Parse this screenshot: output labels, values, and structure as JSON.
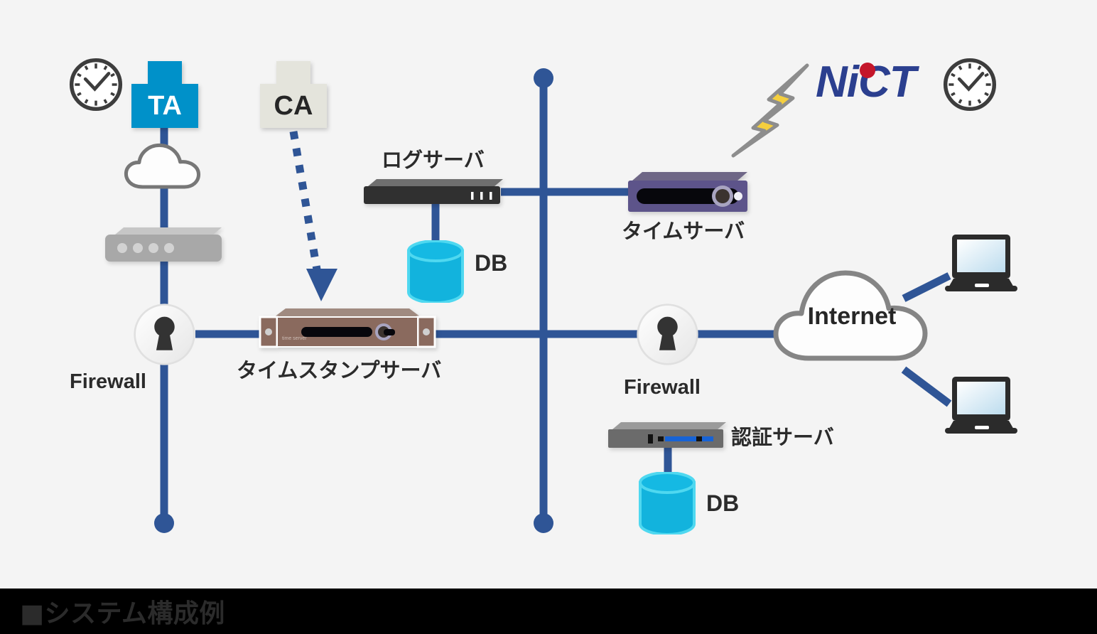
{
  "caption": {
    "bullet": "■",
    "text": "システム構成例",
    "full": "■システム構成例"
  },
  "colors": {
    "wire_blue": "#2f5596",
    "ta_blue": "#0091c9",
    "ca_gray": "#e4e4dc",
    "db_cyan": "#12b3dd",
    "log_server_dark": "#303030",
    "time_server_purple": "#5d548a",
    "timestamp_server_brown": "#8a6a5e",
    "auth_server_gray": "#6b6b6b",
    "router_gray": "#a8a8a8",
    "nict_blue": "#2b3f8f",
    "nict_red": "#c4162a",
    "bolt_yellow": "#f5cf3e",
    "canvas_bg": "#f4f4f4",
    "caption_bg": "#000000",
    "caption_text": "#2b2b2b"
  },
  "nodes": {
    "ta_badge": {
      "label": "TA",
      "kind": "cross-badge"
    },
    "ca_badge": {
      "label": "CA",
      "kind": "cross-badge"
    },
    "clock_left": {
      "icon": "clock-icon"
    },
    "clock_right": {
      "icon": "clock-icon"
    },
    "cloud_left": {
      "icon": "cloud-icon",
      "label": ""
    },
    "router": {
      "icon": "router-icon"
    },
    "firewall_left": {
      "label": "Firewall",
      "icon": "keyhole-icon"
    },
    "firewall_right": {
      "label": "Firewall",
      "icon": "keyhole-icon"
    },
    "timestamp_server": {
      "label": "タイムスタンプサーバ",
      "face_text": "time server"
    },
    "log_server": {
      "label": "ログサーバ"
    },
    "log_db": {
      "label": "DB"
    },
    "time_server": {
      "label": "タイムサーバ"
    },
    "auth_server": {
      "label": "認証サーバ"
    },
    "auth_db": {
      "label": "DB"
    },
    "internet_cloud": {
      "label": "Internet"
    },
    "laptop_top": {
      "icon": "laptop-icon"
    },
    "laptop_bottom": {
      "icon": "laptop-icon"
    },
    "nict_logo": {
      "text": "NiCT",
      "alt": "NICT"
    },
    "lightning": {
      "icon": "lightning-bolt-icon"
    },
    "ca_arrow": {
      "icon": "dashed-arrow-icon",
      "style": "dotted",
      "direction": "down-right"
    }
  }
}
